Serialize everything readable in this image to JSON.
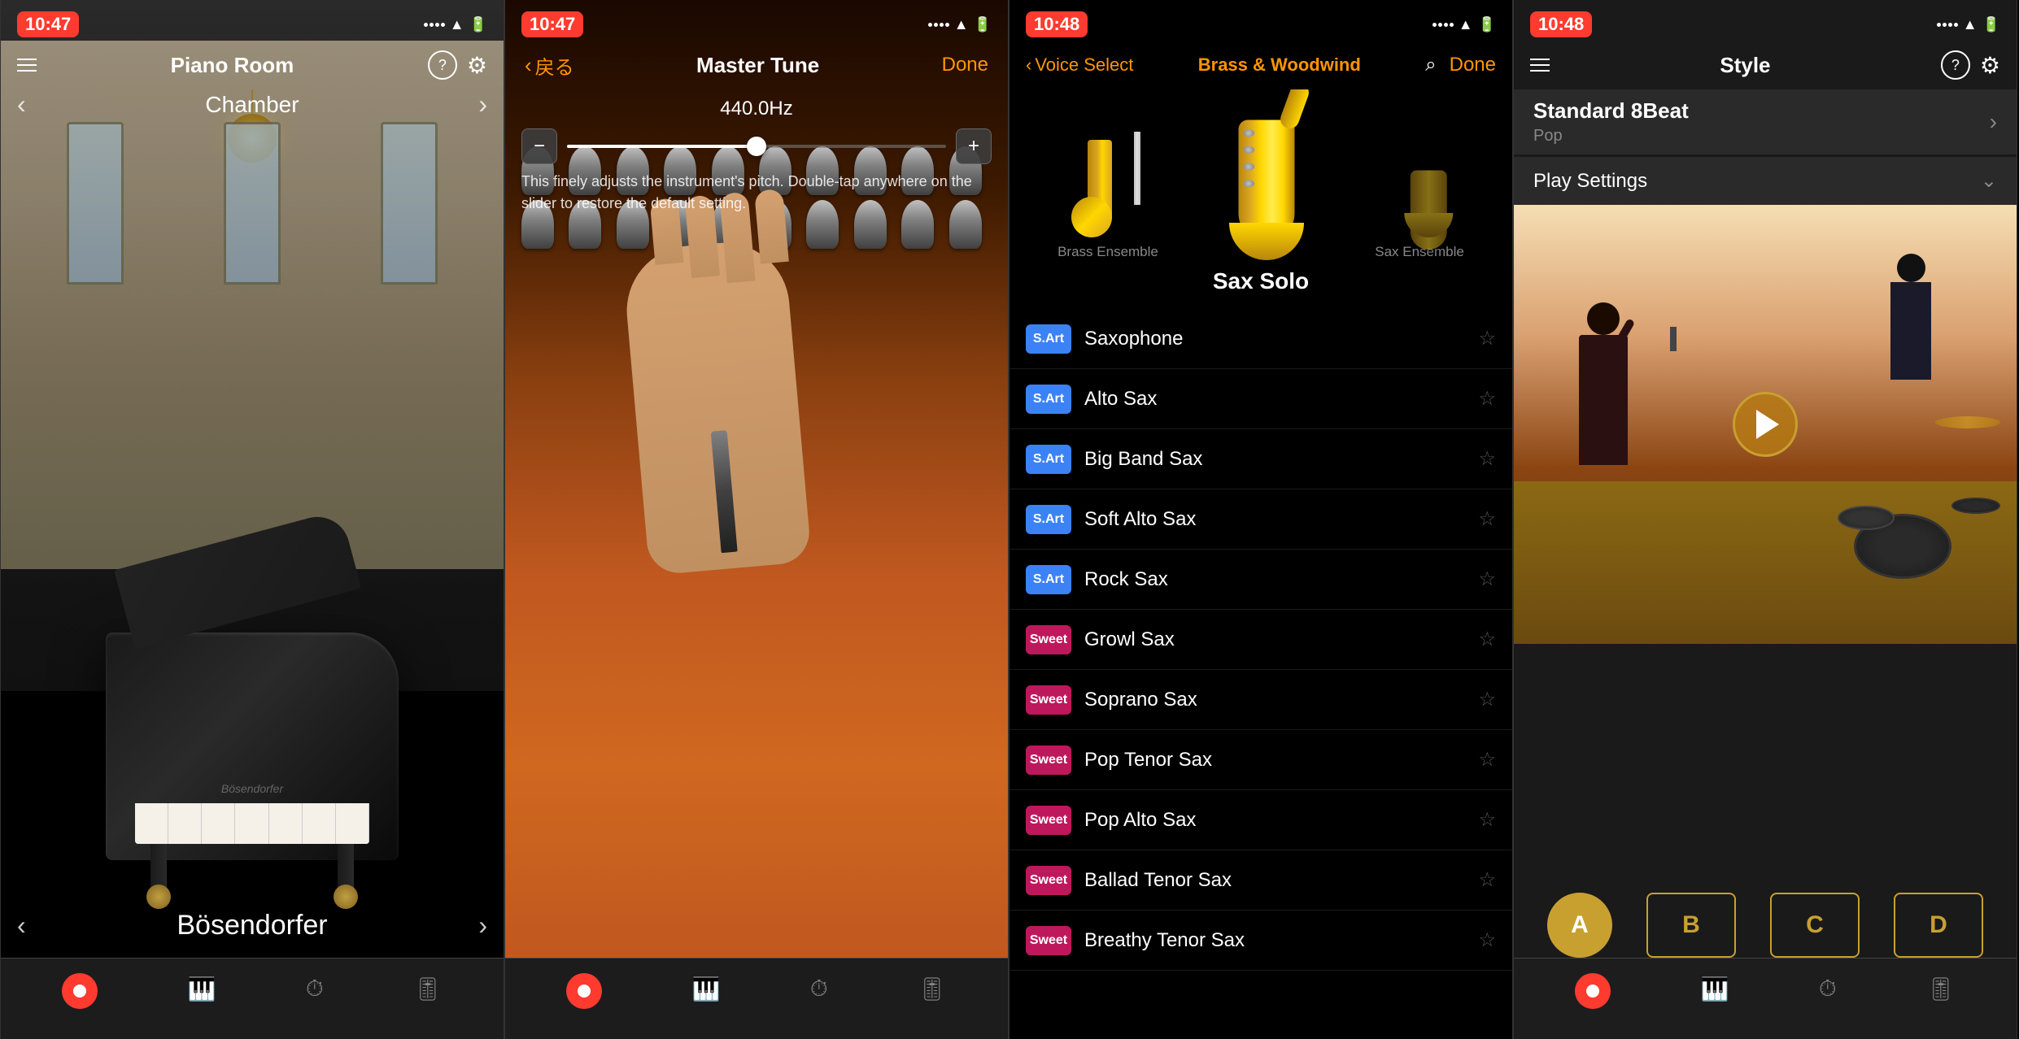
{
  "phone1": {
    "status_time": "10:47",
    "title": "Piano Room",
    "location": "Chamber",
    "piano_name": "Bösendorfer",
    "nav_prev": "‹",
    "nav_next": "›"
  },
  "phone2": {
    "status_time": "10:47",
    "title": "Master Tune",
    "back_label": "戻る",
    "done_label": "Done",
    "hz_value": "440.0Hz",
    "description": "This finely adjusts the instrument's pitch. Double-tap anywhere on\nthe slider to restore the default setting."
  },
  "phone3": {
    "status_time": "10:48",
    "back_label": "Voice Select",
    "category": "Brass & Woodwind",
    "done_label": "Done",
    "selected_instrument": "Sax Solo",
    "instruments": [
      {
        "name": "Brass Ensemble",
        "id": "brass"
      },
      {
        "name": "Sax Solo",
        "id": "sax-solo"
      },
      {
        "name": "Sax Ensemble",
        "id": "sax-ensemble"
      }
    ],
    "voices": [
      {
        "badge": "S.Art",
        "type": "sart",
        "name": "Saxophone"
      },
      {
        "badge": "S.Art",
        "type": "sart",
        "name": "Alto Sax"
      },
      {
        "badge": "S.Art",
        "type": "sart",
        "name": "Big Band Sax"
      },
      {
        "badge": "S.Art",
        "type": "sart",
        "name": "Soft Alto Sax"
      },
      {
        "badge": "S.Art",
        "type": "sart",
        "name": "Rock Sax"
      },
      {
        "badge": "Sweet",
        "type": "sweet",
        "name": "Growl Sax"
      },
      {
        "badge": "Sweet",
        "type": "sweet",
        "name": "Soprano Sax"
      },
      {
        "badge": "Sweet",
        "type": "sweet",
        "name": "Pop Tenor Sax"
      },
      {
        "badge": "Sweet",
        "type": "sweet",
        "name": "Pop Alto Sax"
      },
      {
        "badge": "Sweet",
        "type": "sweet",
        "name": "Ballad Tenor Sax"
      },
      {
        "badge": "Sweet",
        "type": "sweet",
        "name": "Breathy Tenor Sax"
      }
    ]
  },
  "phone4": {
    "status_time": "10:48",
    "title": "Style",
    "style_name": "Standard 8Beat",
    "style_sub": "Pop",
    "play_settings_label": "Play Settings",
    "abcd": [
      "A",
      "B",
      "C",
      "D"
    ]
  },
  "icons": {
    "hamburger": "☰",
    "question": "?",
    "gear": "⚙",
    "search": "⌕",
    "star": "☆",
    "chevron_right": "›",
    "chevron_down": "⌄",
    "back_arrow": "‹",
    "record": "●"
  }
}
